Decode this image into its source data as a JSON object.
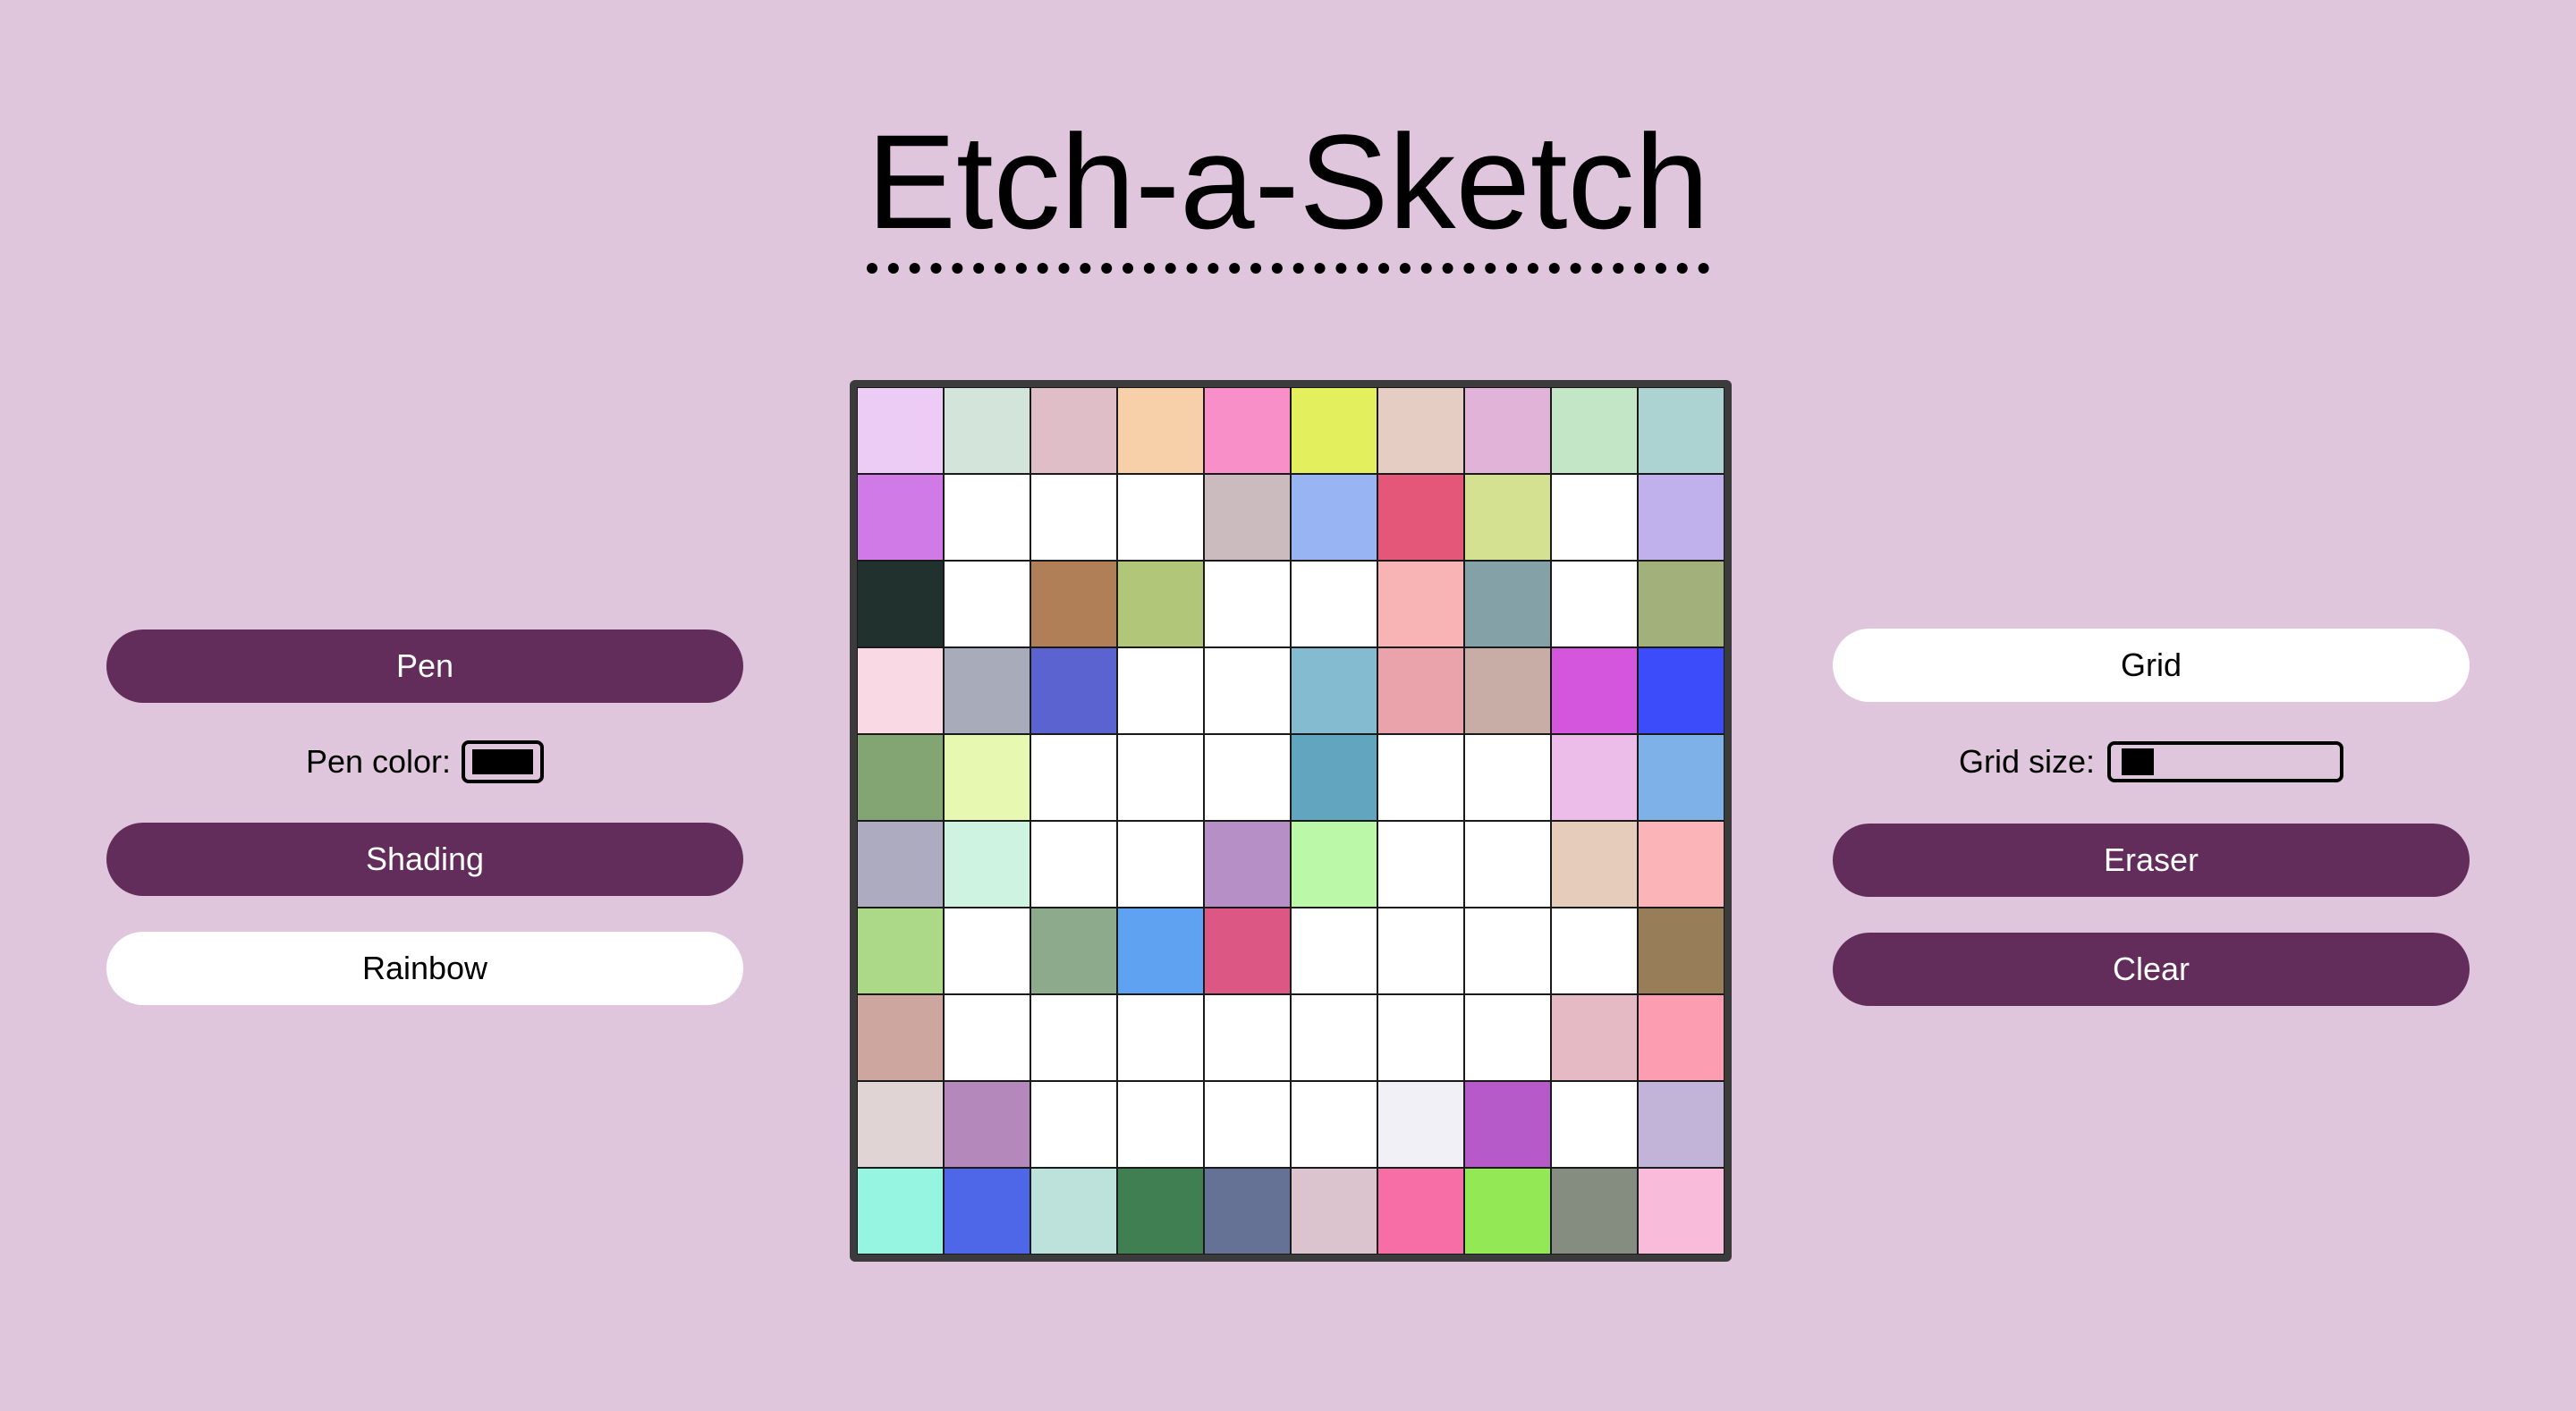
{
  "title": "Etch-a-Sketch",
  "left_controls": {
    "pen_label": "Pen",
    "pen_color_label": "Pen color:",
    "pen_color_value": "#000000",
    "shading_label": "Shading",
    "rainbow_label": "Rainbow"
  },
  "right_controls": {
    "grid_label": "Grid",
    "grid_size_label": "Grid size:",
    "grid_size_value": 10,
    "eraser_label": "Eraser",
    "clear_label": "Clear"
  },
  "colors": {
    "background": "#dfc6dd",
    "button_active": "#632d5b",
    "button_inactive": "#ffffff"
  },
  "grid": {
    "rows": 10,
    "cols": 10,
    "cells": [
      [
        "#ecccf5",
        "#d3e5da",
        "#e0bec8",
        "#f7cfa9",
        "#f98fc8",
        "#e3ef5d",
        "#e5cdc3",
        "#e2b3d8",
        "#c3e6c7",
        "#acd3d2"
      ],
      [
        "#d07ae7",
        "#ffffff",
        "#ffffff",
        "#ffffff",
        "#cbbbbf",
        "#98b4f3",
        "#e55779",
        "#d4e190",
        "#ffffff",
        "#c0b1ec"
      ],
      [
        "#21312d",
        "#ffffff",
        "#b17f57",
        "#b2c679",
        "#ffffff",
        "#ffffff",
        "#f8b4b4",
        "#84a1a8",
        "#ffffff",
        "#a2b07c"
      ],
      [
        "#f8d9e4",
        "#a8abb9",
        "#5b63d1",
        "#ffffff",
        "#ffffff",
        "#85bbd1",
        "#eaa3ab",
        "#c8aca6",
        "#d356dd",
        "#3c4cfa"
      ],
      [
        "#83a473",
        "#e7f9b0",
        "#ffffff",
        "#ffffff",
        "#ffffff",
        "#62a5be",
        "#ffffff",
        "#ffffff",
        "#ebbde8",
        "#7eb1e8"
      ],
      [
        "#adabbf",
        "#cef3e0",
        "#ffffff",
        "#ffffff",
        "#b68fc6",
        "#bbf8a8",
        "#ffffff",
        "#ffffff",
        "#e6cdbb",
        "#fbb5b8"
      ],
      [
        "#acd987",
        "#ffffff",
        "#8dab8c",
        "#60a2f2",
        "#dd5785",
        "#ffffff",
        "#ffffff",
        "#ffffff",
        "#ffffff",
        "#977d58"
      ],
      [
        "#cea6a0",
        "#ffffff",
        "#ffffff",
        "#ffffff",
        "#ffffff",
        "#ffffff",
        "#ffffff",
        "#ffffff",
        "#e5bac4",
        "#fc9db1"
      ],
      [
        "#e0d5d4",
        "#b488ba",
        "#ffffff",
        "#ffffff",
        "#ffffff",
        "#ffffff",
        "#f0f0f6",
        "#b75ac9",
        "#ffffff",
        "#c2b3d8"
      ],
      [
        "#96f5e1",
        "#4d67e8",
        "#bde2db",
        "#407f52",
        "#657195",
        "#dbc4ce",
        "#f76ea7",
        "#93e856",
        "#848d7f",
        "#f8bbda"
      ]
    ]
  }
}
